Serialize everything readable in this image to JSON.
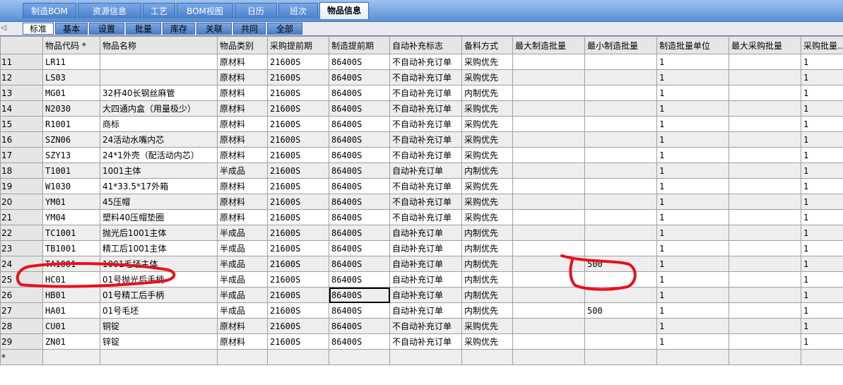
{
  "top_tabs": [
    "制造BOM",
    "资源信息",
    "工艺",
    "BOM视图",
    "日历",
    "班次",
    "物品信息"
  ],
  "sub_tabs": [
    "标准",
    "基本",
    "设置",
    "批量",
    "库存",
    "关联",
    "共同",
    "全部"
  ],
  "columns": [
    "",
    "物品代码 *",
    "物品名称",
    "物品类别",
    "采购提前期",
    "制造提前期",
    "自动补充标志",
    "备料方式",
    "最大制造批量",
    "最小制造批量",
    "制造批量单位",
    "最大采购批量",
    "采购批量..."
  ],
  "rows": [
    [
      "11",
      "LR11",
      "",
      "原材料",
      "21600S",
      "86400S",
      "不自动补充订单",
      "采购优先",
      "",
      "",
      "1",
      "",
      "1"
    ],
    [
      "12",
      "LS03",
      "",
      "原材料",
      "21600S",
      "86400S",
      "不自动补充订单",
      "采购优先",
      "",
      "",
      "1",
      "",
      "1"
    ],
    [
      "13",
      "MG01",
      "32杆40长钢丝麻管",
      "原材料",
      "21600S",
      "86400S",
      "不自动补充订单",
      "内制优先",
      "",
      "",
      "1",
      "",
      "1"
    ],
    [
      "14",
      "N2030",
      "大四通内盒（用量极少）",
      "原材料",
      "21600S",
      "86400S",
      "不自动补充订单",
      "采购优先",
      "",
      "",
      "1",
      "",
      "1"
    ],
    [
      "15",
      "R1001",
      "商标",
      "原材料",
      "21600S",
      "86400S",
      "不自动补充订单",
      "采购优先",
      "",
      "",
      "1",
      "",
      "1"
    ],
    [
      "16",
      "SZN06",
      "24活动水嘴内芯",
      "原材料",
      "21600S",
      "86400S",
      "不自动补充订单",
      "采购优先",
      "",
      "",
      "1",
      "",
      "1"
    ],
    [
      "17",
      "SZY13",
      "24*1外壳（配活动内芯）",
      "原材料",
      "21600S",
      "86400S",
      "不自动补充订单",
      "采购优先",
      "",
      "",
      "1",
      "",
      "1"
    ],
    [
      "18",
      "T1001",
      "1001主体",
      "半成品",
      "21600S",
      "86400S",
      "自动补充订单",
      "内制优先",
      "",
      "",
      "1",
      "",
      "1"
    ],
    [
      "19",
      "W1030",
      "41*33.5*17外箱",
      "原材料",
      "21600S",
      "86400S",
      "不自动补充订单",
      "采购优先",
      "",
      "",
      "1",
      "",
      "1"
    ],
    [
      "20",
      "YM01",
      "45压帽",
      "原材料",
      "21600S",
      "86400S",
      "不自动补充订单",
      "采购优先",
      "",
      "",
      "1",
      "",
      "1"
    ],
    [
      "21",
      "YM04",
      "塑料40压帽垫圈",
      "原材料",
      "21600S",
      "86400S",
      "不自动补充订单",
      "采购优先",
      "",
      "",
      "1",
      "",
      "1"
    ],
    [
      "22",
      "TC1001",
      "抛光后1001主体",
      "半成品",
      "21600S",
      "86400S",
      "自动补充订单",
      "内制优先",
      "",
      "",
      "1",
      "",
      "1"
    ],
    [
      "23",
      "TB1001",
      "精工后1001主体",
      "半成品",
      "21600S",
      "86400S",
      "自动补充订单",
      "内制优先",
      "",
      "",
      "1",
      "",
      "1"
    ],
    [
      "24",
      "TA1001",
      "1001毛坯主体",
      "半成品",
      "21600S",
      "86400S",
      "自动补充订单",
      "内制优先",
      "",
      "500",
      "1",
      "",
      "1"
    ],
    [
      "25",
      "HC01",
      "01号抛光后手柄",
      "半成品",
      "21600S",
      "86400S",
      "自动补充订单",
      "内制优先",
      "",
      "",
      "1",
      "",
      "1"
    ],
    [
      "26",
      "HB01",
      "01号精工后手柄",
      "半成品",
      "21600S",
      "86400S",
      "自动补充订单",
      "内制优先",
      "",
      "",
      "1",
      "",
      "1"
    ],
    [
      "27",
      "HA01",
      "01号毛坯",
      "半成品",
      "21600S",
      "86400S",
      "自动补充订单",
      "内制优先",
      "",
      "500",
      "1",
      "",
      "1"
    ],
    [
      "28",
      "CU01",
      "铜锭",
      "原材料",
      "21600S",
      "86400S",
      "不自动补充订单",
      "采购优先",
      "",
      "",
      "1",
      "",
      "1"
    ],
    [
      "29",
      "ZN01",
      "锌锭",
      "原材料",
      "21600S",
      "86400S",
      "不自动补充订单",
      "采购优先",
      "",
      "",
      "1",
      "",
      "1"
    ]
  ],
  "new_row_marker": "*",
  "arrow_icon": "◁",
  "annotation_color": "#e8101c"
}
